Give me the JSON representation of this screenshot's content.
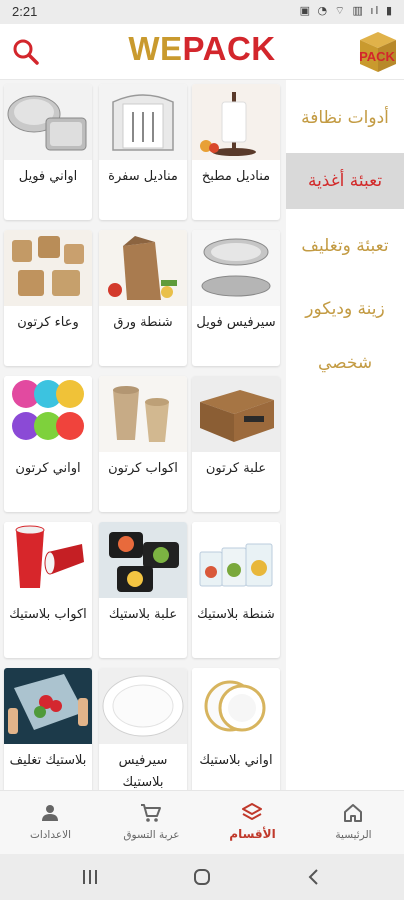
{
  "status_bar": {
    "time": "2:21",
    "icons_text": "▣ ◔ ⌔ ▥ ıl ▮"
  },
  "header": {
    "logo_we": "WE",
    "logo_pack": "PACK",
    "box_logo_text": "PACK"
  },
  "sidebar": {
    "items": [
      {
        "label": "أدوات نظافة",
        "active": false
      },
      {
        "label": "تعبئة أغذية",
        "active": true
      },
      {
        "label": "تعبئة وتغليف",
        "active": false
      },
      {
        "label": "زينة وديكور",
        "active": false
      },
      {
        "label": "شخصي",
        "active": false
      }
    ]
  },
  "products": [
    {
      "label": "مناديل مطبخ",
      "icon": "paper-towel-holder"
    },
    {
      "label": "مناديل سفرة",
      "icon": "napkin-holder"
    },
    {
      "label": "اواني فويل",
      "icon": "foil-trays"
    },
    {
      "label": "سيرفيس فويل",
      "icon": "foil-serving-tray"
    },
    {
      "label": "شنطة ورق",
      "icon": "paper-bag"
    },
    {
      "label": "وعاء كرتون",
      "icon": "kraft-containers"
    },
    {
      "label": "علبة كرتون",
      "icon": "carton-box"
    },
    {
      "label": "اكواب كرتون",
      "icon": "paper-cups"
    },
    {
      "label": "اواني كرتون",
      "icon": "colored-plates"
    },
    {
      "label": "شنطة بلاستيك",
      "icon": "zip-bags"
    },
    {
      "label": "علبة بلاستيك",
      "icon": "plastic-food-box"
    },
    {
      "label": "اكواب بلاستيك",
      "icon": "red-plastic-cups"
    },
    {
      "label": "اواني بلاستيك",
      "icon": "plastic-plates"
    },
    {
      "label": "سيرفيس بلاستيك",
      "icon": "white-oval-tray"
    },
    {
      "label": "بلاستيك تغليف",
      "icon": "cling-wrap"
    }
  ],
  "bottom_nav": [
    {
      "label": "الرئيسية",
      "icon": "home-icon",
      "active": false
    },
    {
      "label": "الأقسام",
      "icon": "categories-icon",
      "active": true
    },
    {
      "label": "عربة التسوق",
      "icon": "cart-icon",
      "active": false
    },
    {
      "label": "الاعدادات",
      "icon": "person-icon",
      "active": false
    }
  ],
  "colors": {
    "accent_gold": "#c99a2e",
    "accent_red": "#d3262c",
    "active_bg": "#d9d9d9"
  }
}
